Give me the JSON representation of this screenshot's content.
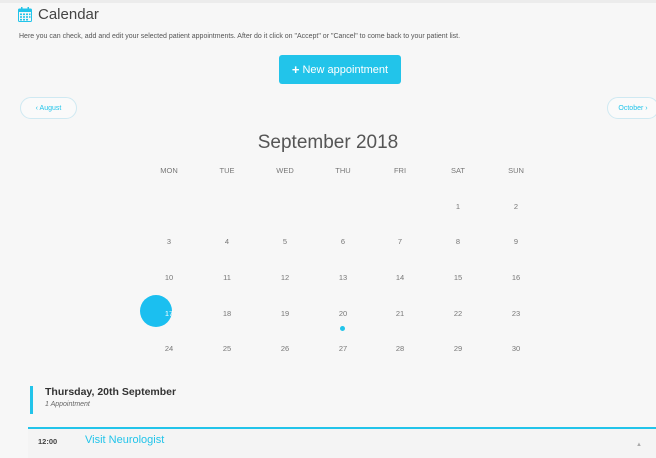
{
  "header": {
    "title": "Calendar",
    "subtitle": "Here you can check, add and edit your selected patient appointments. After do it click on \"Accept\" or \"Cancel\" to come back to your patient list."
  },
  "new_button": {
    "icon": "+",
    "label": "New appointment"
  },
  "nav": {
    "prev": "‹ August",
    "next": "October ›"
  },
  "calendar": {
    "month": "September 2018",
    "weekdays": [
      "MON",
      "TUE",
      "WED",
      "THU",
      "FRI",
      "SAT",
      "SUN"
    ],
    "selected_day": "17",
    "weeks": [
      [
        "",
        "",
        "",
        "",
        "",
        "1",
        "2"
      ],
      [
        "3",
        "4",
        "5",
        "6",
        "7",
        "8",
        "9"
      ],
      [
        "10",
        "11",
        "12",
        "13",
        "14",
        "15",
        "16"
      ],
      [
        "17",
        "18",
        "19",
        "20",
        "21",
        "22",
        "23"
      ],
      [
        "24",
        "25",
        "26",
        "27",
        "28",
        "29",
        "30"
      ]
    ]
  },
  "appointments": {
    "day_title": "Thursday, 20th September",
    "day_count": "1 Appointment",
    "items": [
      {
        "time": "12:00",
        "title": "Visit Neurologist",
        "caret": "▲"
      }
    ]
  },
  "colors": {
    "accent": "#22c4ea",
    "selected": "#1bbff0",
    "background": "#f7f7f7"
  }
}
